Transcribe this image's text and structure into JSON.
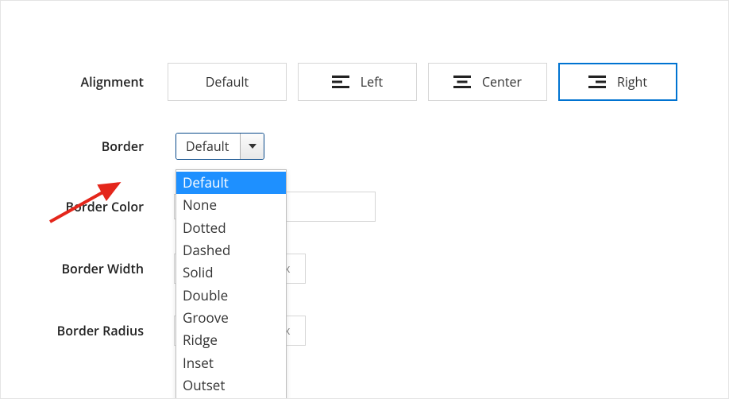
{
  "labels": {
    "alignment": "Alignment",
    "border": "Border",
    "border_color": "Border Color",
    "border_width": "Border Width",
    "border_radius": "Border Radius"
  },
  "alignment": {
    "options": {
      "default": "Default",
      "left": "Left",
      "center": "Center",
      "right": "Right"
    },
    "selected": "right"
  },
  "border": {
    "selected": "Default",
    "options": [
      "Default",
      "None",
      "Dotted",
      "Dashed",
      "Solid",
      "Double",
      "Groove",
      "Ridge",
      "Inset",
      "Outset"
    ]
  },
  "border_color": {
    "value": "",
    "swatch": "#ffffff"
  },
  "border_width": {
    "value": "",
    "unit": "px"
  },
  "border_radius": {
    "value": "",
    "unit": "px"
  }
}
